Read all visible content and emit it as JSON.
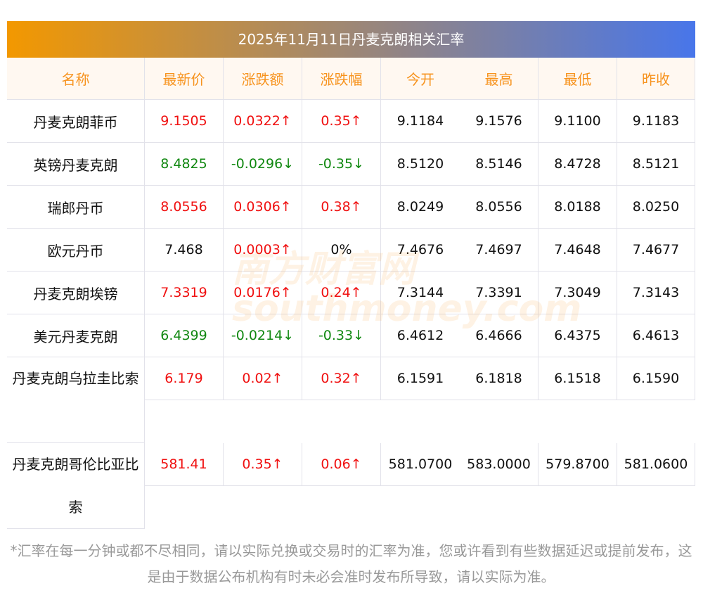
{
  "title": "2025年11月11日丹麦克朗相关汇率",
  "headers": [
    "名称",
    "最新价",
    "涨跌额",
    "涨跌幅",
    "今开",
    "最高",
    "最低",
    "昨收"
  ],
  "rows": [
    {
      "name": "丹麦克朗菲币",
      "price": "9.1505",
      "chg": "0.0322↑",
      "pct": "0.35↑",
      "open": "9.1184",
      "high": "9.1576",
      "low": "9.1100",
      "prev": "9.1183",
      "dir": "up"
    },
    {
      "name": "英镑丹麦克朗",
      "price": "8.4825",
      "chg": "-0.0296↓",
      "pct": "-0.35↓",
      "open": "8.5120",
      "high": "8.5146",
      "low": "8.4728",
      "prev": "8.5121",
      "dir": "down"
    },
    {
      "name": "瑞郎丹币",
      "price": "8.0556",
      "chg": "0.0306↑",
      "pct": "0.38↑",
      "open": "8.0249",
      "high": "8.0556",
      "low": "8.0188",
      "prev": "8.0250",
      "dir": "up"
    },
    {
      "name": "欧元丹币",
      "price": "7.468",
      "chg": "0.0003↑",
      "pct": "0%",
      "open": "7.4676",
      "high": "7.4697",
      "low": "7.4648",
      "prev": "7.4677",
      "dir": "flat"
    },
    {
      "name": "丹麦克朗埃镑",
      "price": "7.3319",
      "chg": "0.0176↑",
      "pct": "0.24↑",
      "open": "7.3144",
      "high": "7.3391",
      "low": "7.3049",
      "prev": "7.3143",
      "dir": "up"
    },
    {
      "name": "美元丹麦克朗",
      "price": "6.4399",
      "chg": "-0.0214↓",
      "pct": "-0.33↓",
      "open": "6.4612",
      "high": "6.4666",
      "low": "6.4375",
      "prev": "6.4613",
      "dir": "down"
    },
    {
      "name": "丹麦克朗乌拉圭比索",
      "price": "6.179",
      "chg": "0.02↑",
      "pct": "0.32↑",
      "open": "6.1591",
      "high": "6.1818",
      "low": "6.1518",
      "prev": "6.1590",
      "dir": "up"
    },
    {
      "name": "丹麦克朗哥伦比亚比索",
      "price": "581.41",
      "chg": "0.35↑",
      "pct": "0.06↑",
      "open": "581.0700",
      "high": "583.0000",
      "low": "579.8700",
      "prev": "581.0600",
      "dir": "up"
    }
  ],
  "watermark": {
    "cn": "南方财富网",
    "en": "southmoney.com"
  },
  "note": "*汇率在每一分钟或都不尽相同，请以实际兑换或交易时的汇率为准，您或许看到有些数据延迟或提前发布，这是由于数据公布机构有时未必会准时发布所导致，请以实际为准。"
}
